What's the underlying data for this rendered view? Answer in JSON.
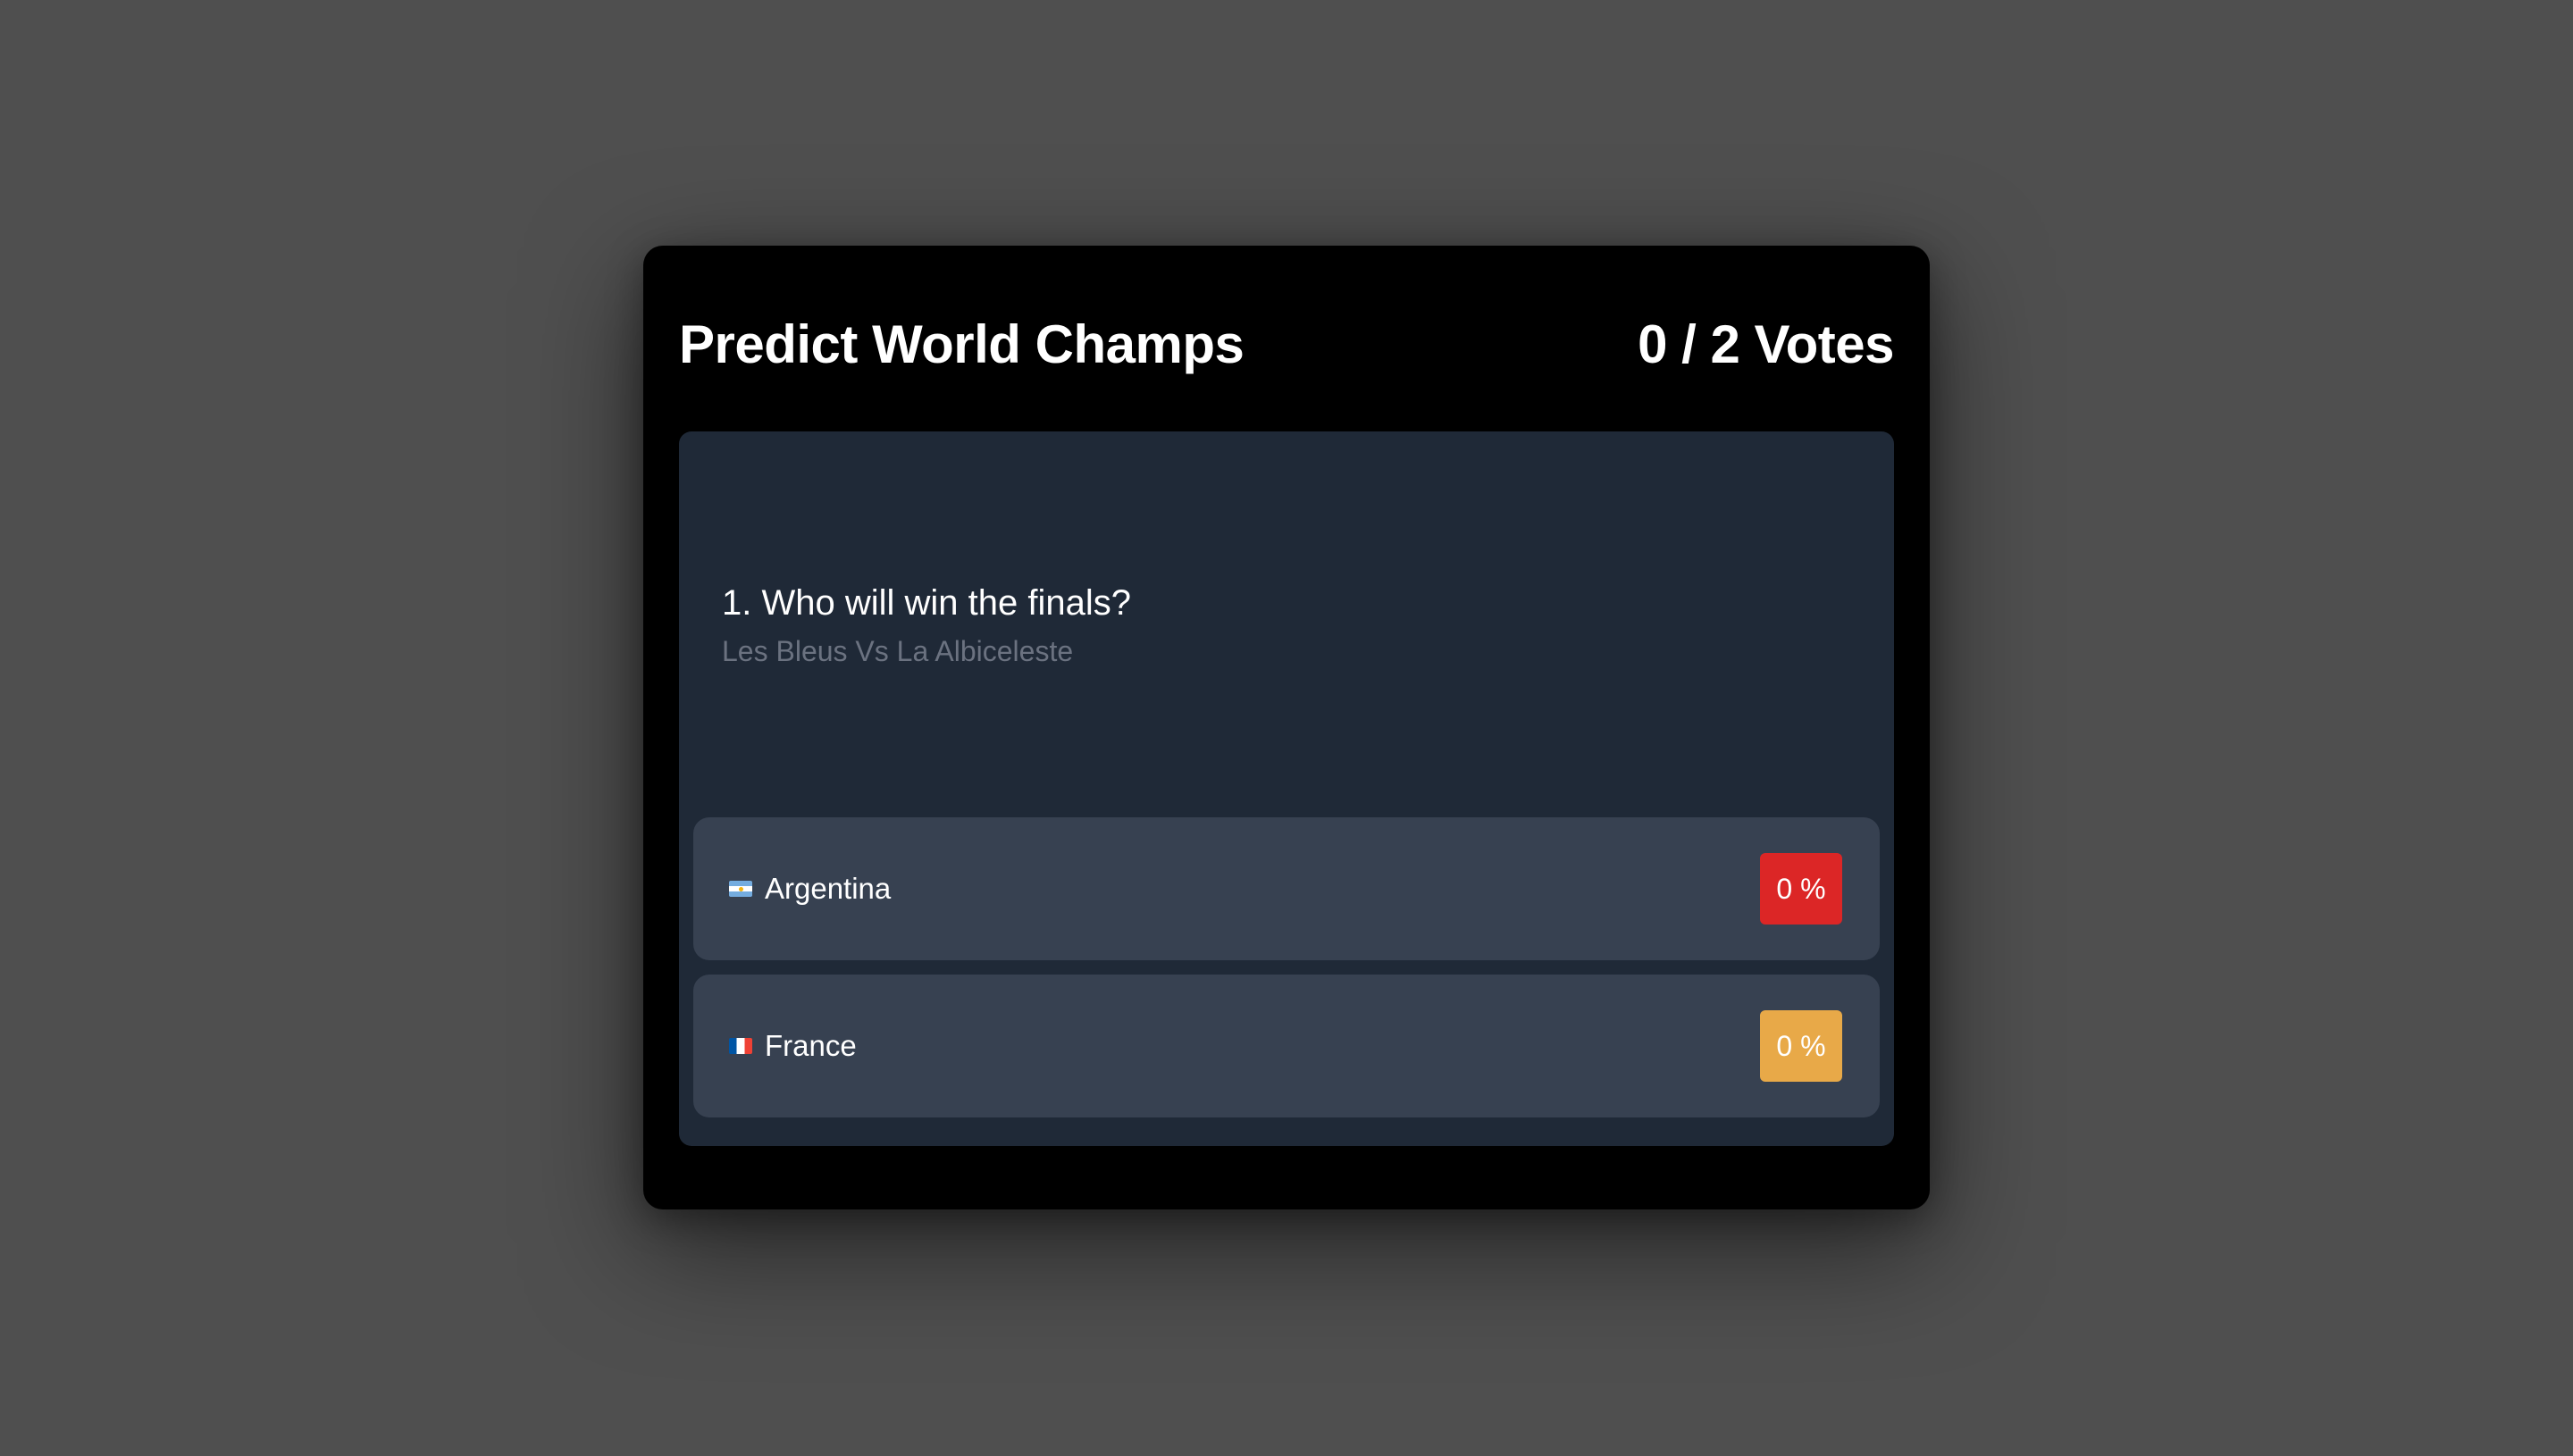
{
  "header": {
    "title": "Predict World Champs",
    "votes": "0 / 2 Votes"
  },
  "question": {
    "text": "1. Who will win the finals?",
    "subtitle": "Les Bleus Vs La Albiceleste"
  },
  "options": [
    {
      "flag_icon": "argentina-flag-icon",
      "label": "Argentina",
      "percent": "0 %",
      "badge_color": "#dc2626",
      "value": 0
    },
    {
      "flag_icon": "france-flag-icon",
      "label": "France",
      "percent": "0 %",
      "badge_color": "#e8a948",
      "value": 0
    }
  ],
  "colors": {
    "page_background": "#4f4f4f",
    "card_background": "#000000",
    "panel_background": "#1f2937",
    "option_background": "#374151",
    "subtitle_text": "#6b7280"
  }
}
